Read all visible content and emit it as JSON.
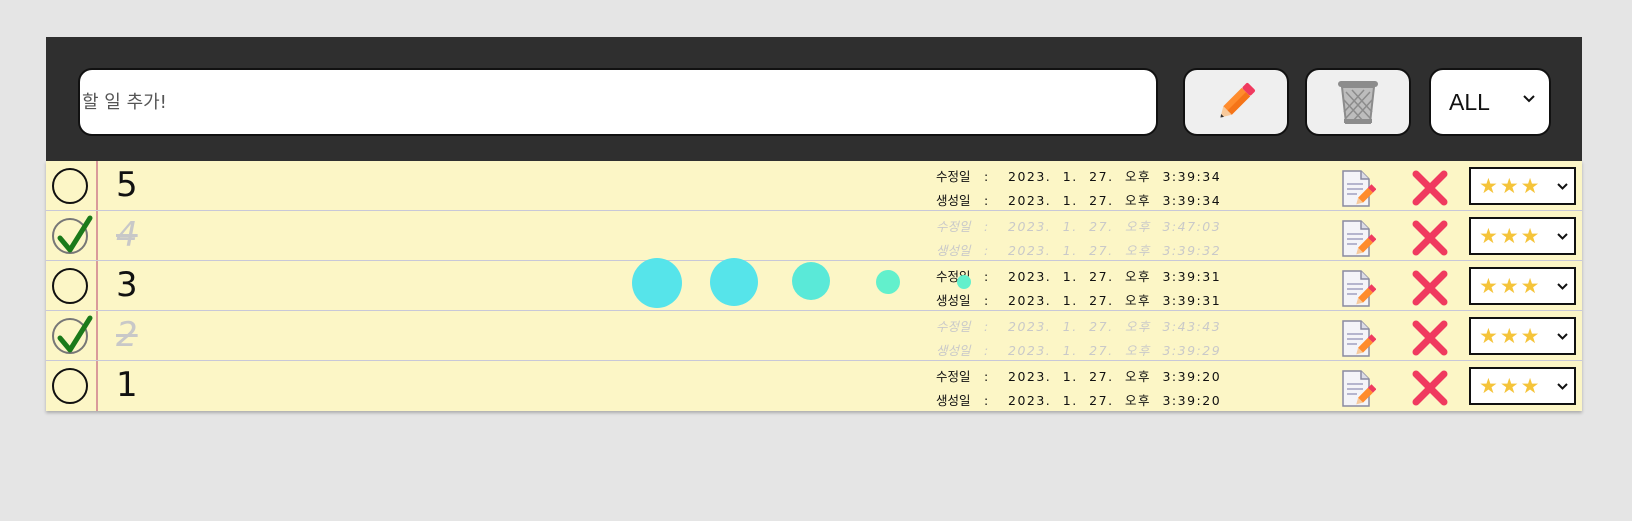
{
  "header": {
    "input_placeholder": "할 일 추가!",
    "filter_value": "ALL",
    "add_icon": "pencil-icon",
    "delete_icon": "trash-icon"
  },
  "labels": {
    "modified": "수정일",
    "created": "생성일",
    "colon": ":"
  },
  "todos": [
    {
      "title": "5",
      "done": false,
      "modified": "2023. 1. 27. 오후 3:39:34",
      "created": "2023. 1. 27. 오후 3:39:34",
      "rating": "★★★"
    },
    {
      "title": "4",
      "done": true,
      "modified": "2023. 1. 27. 오후 3:47:03",
      "created": "2023. 1. 27. 오후 3:39:32",
      "rating": "★★★"
    },
    {
      "title": "3",
      "done": false,
      "modified": "2023. 1. 27. 오후 3:39:31",
      "created": "2023. 1. 27. 오후 3:39:31",
      "rating": "★★★"
    },
    {
      "title": "2",
      "done": true,
      "modified": "2023. 1. 27. 오후 3:43:43",
      "created": "2023. 1. 27. 오후 3:39:29",
      "rating": "★★★"
    },
    {
      "title": "1",
      "done": false,
      "modified": "2023. 1. 27. 오후 3:39:20",
      "created": "2023. 1. 27. 오후 3:39:20",
      "rating": "★★★"
    }
  ],
  "colors": {
    "header_bg": "#2f2f2f",
    "list_bg": "#fcf6c6",
    "check_green": "#1a7a1a",
    "delete_red": "#f03a5f",
    "star_yellow": "#f5c43a",
    "loader_cyan": "#56e4ea",
    "loader_mint": "#62f0cc"
  }
}
